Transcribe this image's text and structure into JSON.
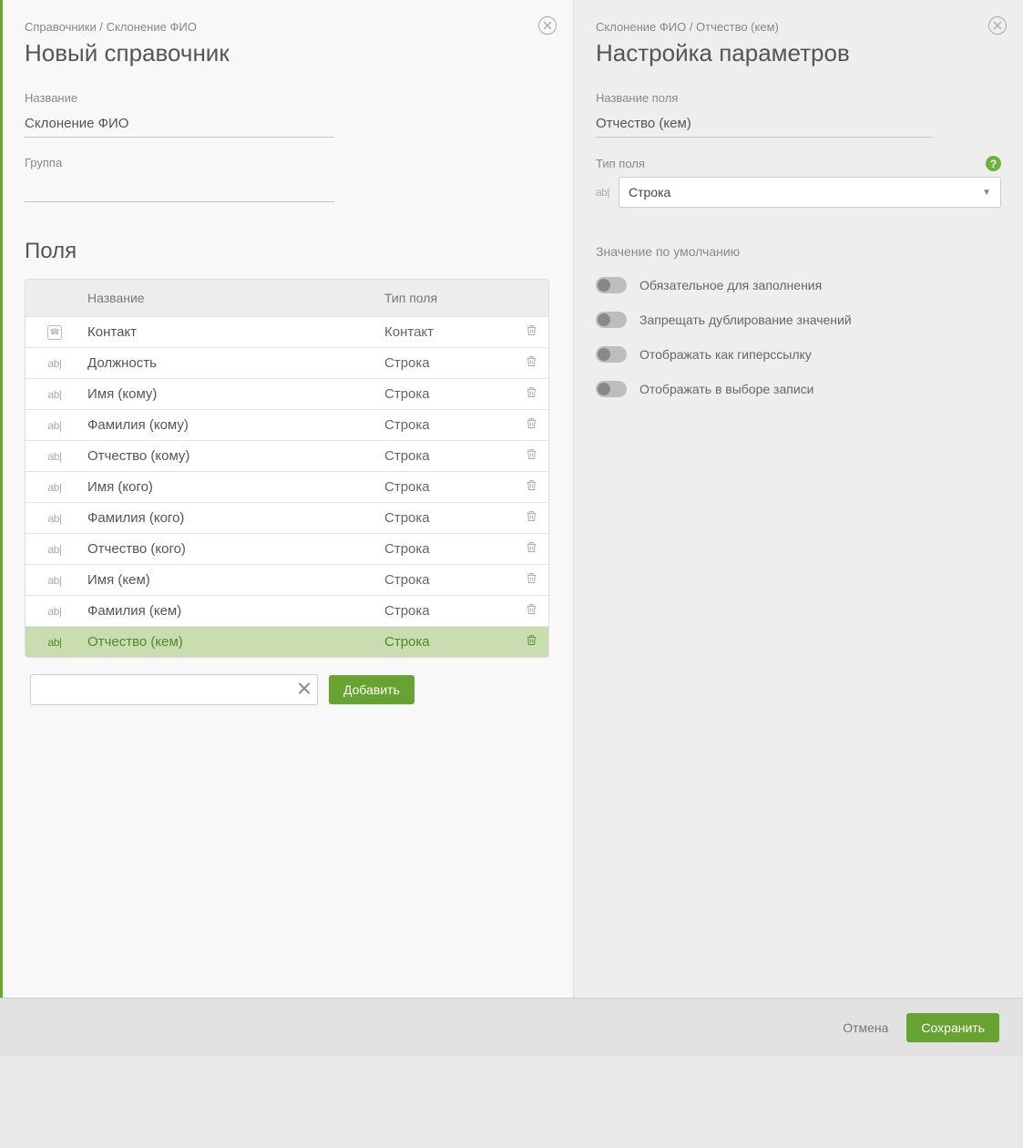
{
  "left": {
    "breadcrumb": "Справочники / Склонение ФИО",
    "title": "Новый справочник",
    "name_label": "Название",
    "name_value": "Склонение ФИО",
    "group_label": "Группа",
    "group_value": "",
    "fields_heading": "Поля",
    "columns": {
      "name": "Название",
      "type": "Тип поля"
    },
    "rows": [
      {
        "icon": "contact",
        "name": "Контакт",
        "type": "Контакт",
        "selected": false
      },
      {
        "icon": "ab",
        "name": "Должность",
        "type": "Строка",
        "selected": false
      },
      {
        "icon": "ab",
        "name": "Имя (кому)",
        "type": "Строка",
        "selected": false
      },
      {
        "icon": "ab",
        "name": "Фамилия (кому)",
        "type": "Строка",
        "selected": false
      },
      {
        "icon": "ab",
        "name": "Отчество (кому)",
        "type": "Строка",
        "selected": false
      },
      {
        "icon": "ab",
        "name": "Имя (кого)",
        "type": "Строка",
        "selected": false
      },
      {
        "icon": "ab",
        "name": "Фамилия (кого)",
        "type": "Строка",
        "selected": false
      },
      {
        "icon": "ab",
        "name": "Отчество (кого)",
        "type": "Строка",
        "selected": false
      },
      {
        "icon": "ab",
        "name": "Имя (кем)",
        "type": "Строка",
        "selected": false
      },
      {
        "icon": "ab",
        "name": "Фамилия (кем)",
        "type": "Строка",
        "selected": false
      },
      {
        "icon": "ab",
        "name": "Отчество (кем)",
        "type": "Строка",
        "selected": true
      }
    ],
    "add_button": "Добавить"
  },
  "right": {
    "breadcrumb": "Склонение ФИО / Отчество (кем)",
    "title": "Настройка параметров",
    "name_label": "Название поля",
    "name_value": "Отчество (кем)",
    "type_label": "Тип поля",
    "type_value": "Строка",
    "default_label": "Значение по умолчанию",
    "toggles": [
      "Обязательное для заполнения",
      "Запрещать дублирование значений",
      "Отображать как гиперссылку",
      "Отображать в выборе записи"
    ]
  },
  "footer": {
    "cancel": "Отмена",
    "save": "Сохранить"
  },
  "icons": {
    "ab": "ab|"
  }
}
